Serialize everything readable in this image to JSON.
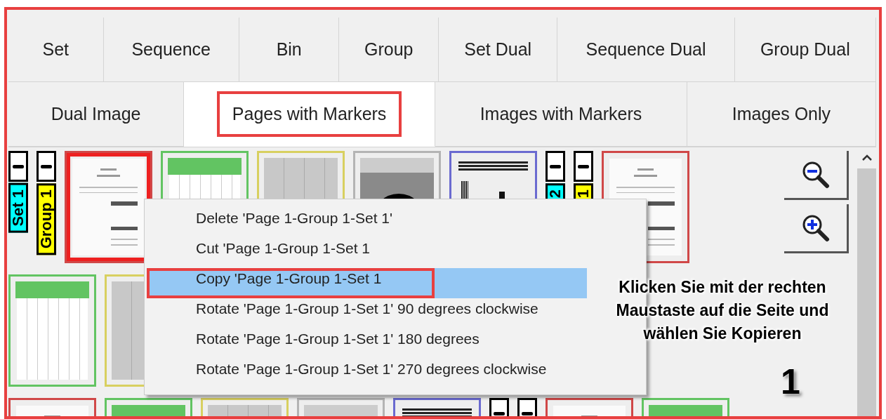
{
  "tabs_row_1": [
    {
      "label": "Set",
      "selected": false
    },
    {
      "label": "Sequence",
      "selected": false
    },
    {
      "label": "Bin",
      "selected": false
    },
    {
      "label": "Group",
      "selected": false
    },
    {
      "label": "Set Dual",
      "selected": false
    },
    {
      "label": "Sequence Dual",
      "selected": false
    },
    {
      "label": "Group Dual",
      "selected": false
    }
  ],
  "tabs_row_2": [
    {
      "label": "Dual Image",
      "selected": false,
      "highlighted": false
    },
    {
      "label": "Pages with Markers",
      "selected": true,
      "highlighted": true
    },
    {
      "label": "Images with Markers",
      "selected": false,
      "highlighted": false
    },
    {
      "label": "Images Only",
      "selected": false,
      "highlighted": false
    }
  ],
  "thumbnail_rows": [
    [
      {
        "kind": "marker",
        "label": "Set 1",
        "color": "#00ffff"
      },
      {
        "kind": "marker",
        "label": "Group 1",
        "color": "#ffff00"
      },
      {
        "kind": "page",
        "color": "#d04848",
        "selected": true
      },
      {
        "kind": "table",
        "color": "#62c462",
        "selected": false
      },
      {
        "kind": "scan",
        "color": "#d8d060",
        "selected": false
      },
      {
        "kind": "image",
        "color": "#b4b4b4",
        "selected": false
      },
      {
        "kind": "barcode",
        "color": "#6a6ad0",
        "selected": false
      },
      {
        "kind": "marker",
        "label": "2",
        "color": "#00ffff"
      },
      {
        "kind": "marker",
        "label": "1",
        "color": "#ffff00"
      },
      {
        "kind": "page",
        "color": "#d04848",
        "selected": false
      }
    ],
    [
      {
        "kind": "table",
        "color": "#62c462",
        "selected": false
      },
      {
        "kind": "scan",
        "color": "#d8d060",
        "selected": false
      }
    ],
    [
      {
        "kind": "page",
        "color": "#d04848",
        "selected": false
      },
      {
        "kind": "table",
        "color": "#62c462",
        "selected": false
      },
      {
        "kind": "scan",
        "color": "#d8d060",
        "selected": false
      },
      {
        "kind": "image",
        "color": "#b4b4b4",
        "selected": false
      },
      {
        "kind": "barcode",
        "color": "#6a6ad0",
        "selected": false
      },
      {
        "kind": "marker"
      },
      {
        "kind": "marker"
      },
      {
        "kind": "page",
        "color": "#d04848",
        "selected": false
      },
      {
        "kind": "table",
        "color": "#62c462",
        "selected": false
      }
    ]
  ],
  "context_menu": {
    "items": [
      {
        "label": "Delete 'Page 1-Group 1-Set 1'",
        "selected": false,
        "highlighted": false
      },
      {
        "label": "Cut 'Page 1-Group 1-Set 1",
        "selected": false,
        "highlighted": false
      },
      {
        "label": "Copy 'Page 1-Group 1-Set 1",
        "selected": true,
        "highlighted": true
      },
      {
        "label": "Rotate 'Page 1-Group 1-Set 1' 90 degrees clockwise",
        "selected": false,
        "highlighted": false
      },
      {
        "label": "Rotate 'Page 1-Group 1-Set 1' 180 degrees",
        "selected": false,
        "highlighted": false
      },
      {
        "label": "Rotate 'Page 1-Group 1-Set 1' 270 degrees clockwise",
        "selected": false,
        "highlighted": false
      }
    ]
  },
  "annotation": {
    "text": "Klicken Sie mit der rechten Maustaste auf die Seite und wählen Sie Kopieren",
    "step": "1"
  }
}
